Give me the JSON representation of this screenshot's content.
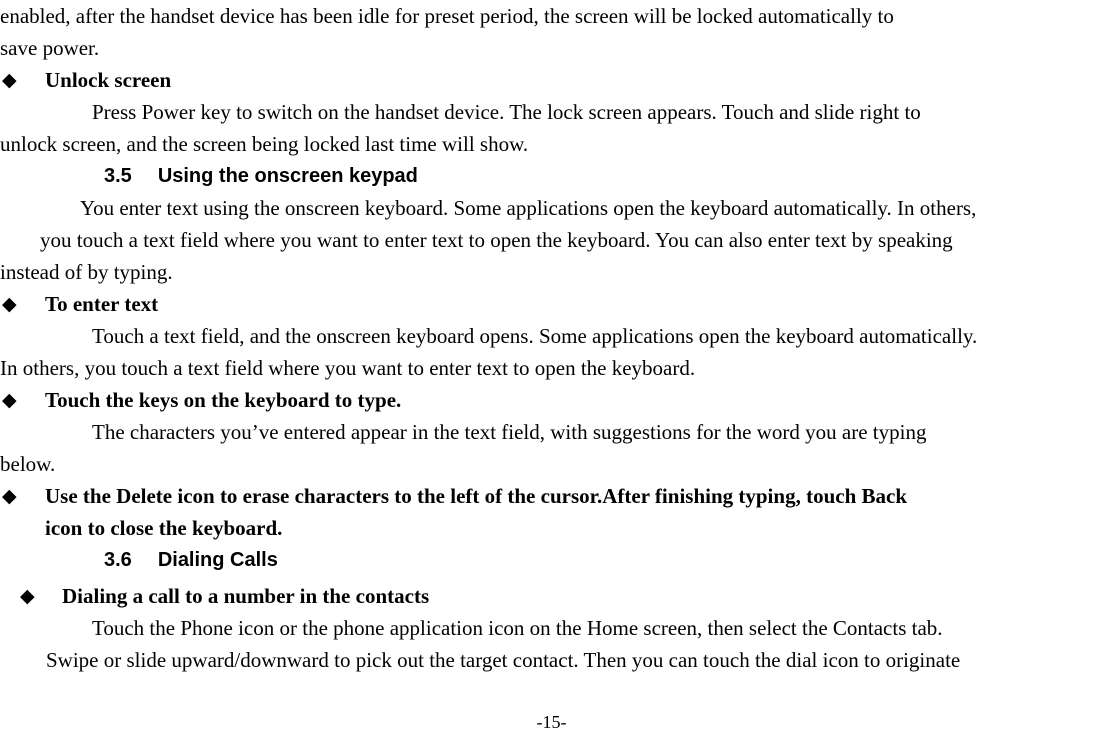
{
  "document": {
    "page_number": "-15-",
    "bullet_glyph": "◆"
  },
  "blocks": {
    "intro_paragraph": {
      "line1": "enabled, after the handset device has been idle for preset period, the screen will be locked automatically to",
      "line2": "save power."
    },
    "unlock_screen_bullet": {
      "label": "Unlock screen"
    },
    "unlock_screen_body": {
      "line1": "Press Power key to switch on the handset device. The lock screen appears. Touch and slide right to",
      "line2": "unlock screen, and the screen being locked last time will show."
    },
    "section_3_5": {
      "number": "3.5",
      "title": "Using the onscreen keypad"
    },
    "keypad_paragraph": {
      "line1": "You enter text using the onscreen keyboard. Some applications open the keyboard automatically. In others,",
      "line2": "you touch a text field where you want to enter text to open the keyboard. You can also enter text by speaking",
      "line3": "instead of by typing."
    },
    "to_enter_text_bullet": {
      "label": "To enter text"
    },
    "to_enter_text_body": {
      "line1": "Touch a text field, and the onscreen keyboard opens. Some applications open the keyboard automatically.",
      "line2": "In others, you touch a text field where you want to enter text to open the keyboard."
    },
    "touch_keys_bullet": {
      "label": "Touch the keys on the keyboard to type."
    },
    "touch_keys_body": {
      "line1": "The characters you’ve entered appear in the text field, with suggestions for the word you are typing",
      "line2": "below."
    },
    "delete_icon_bullet": {
      "line1": "Use the Delete icon to erase characters to the left of the cursor.After finishing typing, touch Back",
      "line2": "icon to close the keyboard."
    },
    "section_3_6": {
      "number": "3.6",
      "title": "Dialing Calls"
    },
    "dialing_contact_bullet": {
      "label": "Dialing a call to a number in the contacts"
    },
    "dialing_contact_body": {
      "line1": "Touch the Phone icon or the phone application icon on the Home screen, then select the Contacts tab.",
      "line2": "Swipe or slide upward/downward to pick out the target contact. Then you can touch the dial icon to originate"
    }
  }
}
